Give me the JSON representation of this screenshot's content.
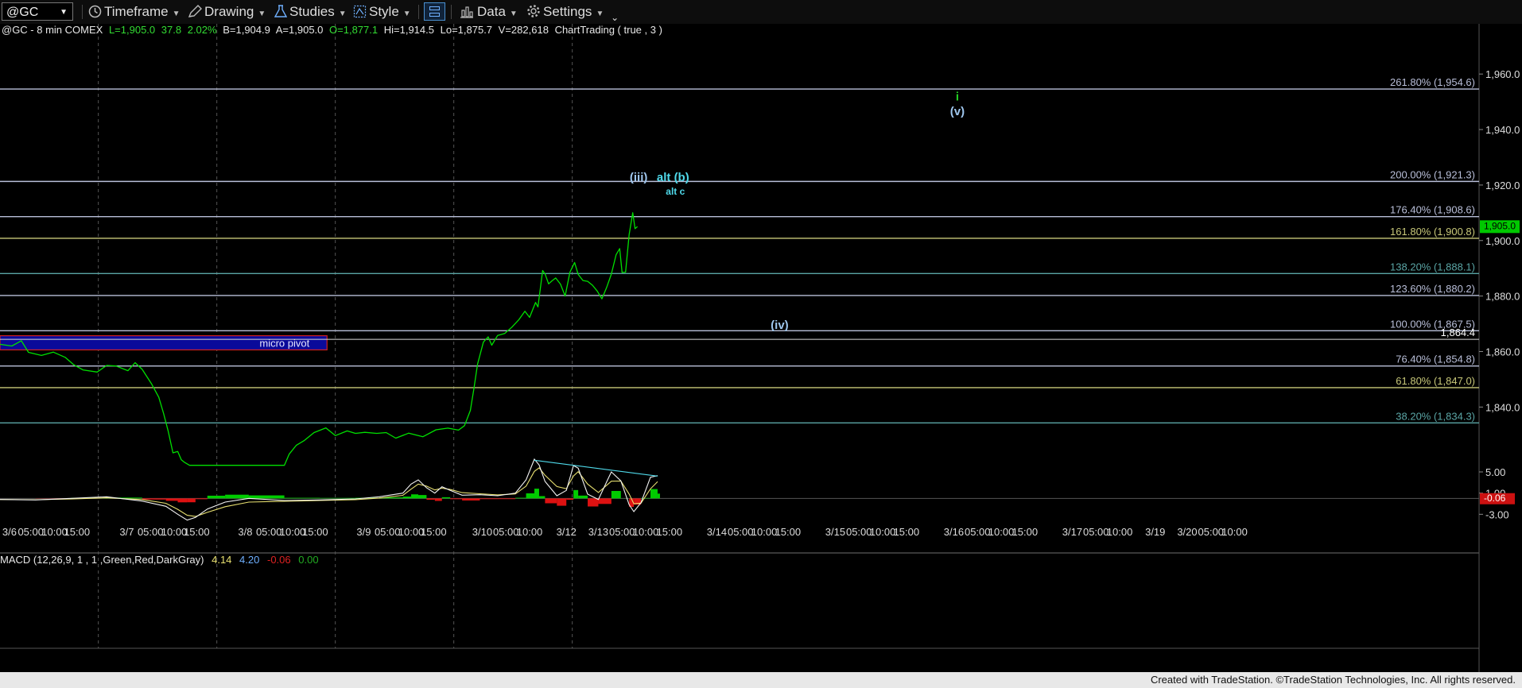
{
  "toolbar": {
    "symbol": "@GC",
    "timeframe": "Timeframe",
    "drawing": "Drawing",
    "studies": "Studies",
    "style": "Style",
    "data": "Data",
    "settings": "Settings"
  },
  "header": {
    "symbol_desc": "@GC - 8 min  COMEX",
    "last": "L=1,905.0",
    "change": "37.8",
    "change_pct": "2.02%",
    "bid": "B=1,904.9",
    "ask": "A=1,905.0",
    "open": "O=1,877.1",
    "high": "Hi=1,914.5",
    "low": "Lo=1,875.7",
    "volume": "V=282,618",
    "indicator": "ChartTrading ( true , 3 )"
  },
  "colors": {
    "price_line": "#00e000",
    "wave_cyan": "#4fd9ea",
    "wave_label": "#9fc7ee",
    "fib_gray": "#b9bfd9",
    "fib_olive": "#c8c879",
    "fib_teal": "#5aa5a5",
    "pivot_fill": "#0a0a9a",
    "macd_neg": "#dd1111"
  },
  "fibs": [
    {
      "label": "261.80% (1,954.6)",
      "price": 1954.6,
      "color": "#b9bfd9"
    },
    {
      "label": "200.00% (1,921.3)",
      "price": 1921.3,
      "color": "#b9bfd9"
    },
    {
      "label": "176.40% (1,908.6)",
      "price": 1908.6,
      "color": "#b9bfd9"
    },
    {
      "label": "161.80% (1,900.8)",
      "price": 1900.8,
      "color": "#c8c879"
    },
    {
      "label": "138.20% (1,888.1)",
      "price": 1888.1,
      "color": "#5aa5a5"
    },
    {
      "label": "123.60% (1,880.2)",
      "price": 1880.2,
      "color": "#b9bfd9"
    },
    {
      "label": "100.00% (1,867.5)",
      "price": 1867.5,
      "color": "#b9bfd9"
    },
    {
      "label": "76.40% (1,854.8)",
      "price": 1854.8,
      "color": "#b9bfd9"
    },
    {
      "label": "61.80% (1,847.0)",
      "price": 1847.0,
      "color": "#c8c879"
    },
    {
      "label": "38.20% (1,834.3)",
      "price": 1834.3,
      "color": "#5aa5a5"
    }
  ],
  "pivot_level": {
    "label": "1,864.4",
    "price": 1864.4
  },
  "micro_pivot": {
    "label": "micro pivot",
    "price_top": 1865.7,
    "price_bottom": 1860.6,
    "bar_start": 0,
    "bar_end": 276
  },
  "price_axis": {
    "ticks": [
      "1,960.0",
      "1,940.0",
      "1,920.0",
      "1,900.0",
      "1,880.0",
      "1,860.0",
      "1,840.0"
    ],
    "values": [
      1960,
      1940,
      1920,
      1900,
      1880,
      1860,
      1840
    ],
    "min": 1823.5,
    "max": 1969.5
  },
  "current_price": {
    "label": "1,905.0",
    "price": 1905.0
  },
  "wave_labels": [
    {
      "text": "(iii)",
      "bar": 539,
      "price": 1921.4,
      "color": "#9fc7ee"
    },
    {
      "text": "alt (b)",
      "bar": 568,
      "price": 1921.4,
      "color": "#4fd9ea"
    },
    {
      "text": "alt c",
      "bar": 570,
      "price": 1916.6,
      "color": "#4fd9ea"
    },
    {
      "text": "(iv)",
      "bar": 658,
      "price": 1868.1,
      "color": "#9fc7ee"
    },
    {
      "text": "i",
      "bar": 808,
      "price": 1950.4,
      "color": "#22cc22"
    },
    {
      "text": "(v)",
      "bar": 808,
      "price": 1945.2,
      "color": "#9fc7ee"
    }
  ],
  "price_path": [
    [
      0,
      1862.6
    ],
    [
      10,
      1862
    ],
    [
      18,
      1863.9
    ],
    [
      24,
      1859.7
    ],
    [
      35,
      1858.6
    ],
    [
      45,
      1859.8
    ],
    [
      55,
      1857.9
    ],
    [
      62,
      1855.3
    ],
    [
      70,
      1853.4
    ],
    [
      82,
      1852.6
    ],
    [
      90,
      1855
    ],
    [
      98,
      1854.8
    ],
    [
      108,
      1853.1
    ],
    [
      114,
      1856
    ],
    [
      120,
      1853.6
    ],
    [
      128,
      1848.3
    ],
    [
      134,
      1843.5
    ],
    [
      138,
      1837.8
    ],
    [
      142,
      1831.2
    ],
    [
      146,
      1823.5
    ],
    [
      150,
      1824
    ],
    [
      153,
      1821
    ],
    [
      156,
      1820
    ],
    [
      160,
      1819
    ],
    [
      240,
      1819
    ],
    [
      244,
      1823
    ],
    [
      250,
      1826.2
    ],
    [
      257,
      1828
    ],
    [
      265,
      1830.8
    ],
    [
      275,
      1832.5
    ],
    [
      283,
      1829.7
    ],
    [
      293,
      1831.4
    ],
    [
      300,
      1830.5
    ],
    [
      308,
      1830.9
    ],
    [
      318,
      1830.5
    ],
    [
      326,
      1830.8
    ],
    [
      334,
      1828.8
    ],
    [
      345,
      1830.6
    ],
    [
      357,
      1829.3
    ],
    [
      368,
      1831.8
    ],
    [
      378,
      1832.4
    ],
    [
      387,
      1831.7
    ],
    [
      392,
      1833.3
    ],
    [
      397,
      1838.8
    ],
    [
      400,
      1846.7
    ],
    [
      403,
      1855.4
    ],
    [
      408,
      1863.4
    ],
    [
      412,
      1865.3
    ],
    [
      415,
      1862.3
    ],
    [
      420,
      1865.8
    ],
    [
      426,
      1866.5
    ],
    [
      432,
      1868.8
    ],
    [
      438,
      1871.5
    ],
    [
      443,
      1874.5
    ],
    [
      447,
      1872.3
    ],
    [
      452,
      1877.7
    ],
    [
      454,
      1876.1
    ],
    [
      456,
      1882.5
    ],
    [
      458,
      1889.2
    ],
    [
      460,
      1888
    ],
    [
      463,
      1884.4
    ],
    [
      466,
      1885.5
    ],
    [
      469,
      1886.5
    ],
    [
      473,
      1884.3
    ],
    [
      477,
      1880
    ],
    [
      481,
      1888.6
    ],
    [
      485,
      1892.1
    ],
    [
      488,
      1887.8
    ],
    [
      492,
      1885.6
    ],
    [
      496,
      1885.3
    ],
    [
      500,
      1883.9
    ],
    [
      504,
      1881.8
    ],
    [
      508,
      1879
    ],
    [
      512,
      1883.1
    ],
    [
      516,
      1887.9
    ],
    [
      520,
      1894.9
    ],
    [
      523,
      1897.1
    ],
    [
      525,
      1888.5
    ],
    [
      528,
      1888.6
    ],
    [
      531,
      1902.2
    ],
    [
      534,
      1910
    ],
    [
      536,
      1904.3
    ],
    [
      538,
      1905
    ]
  ],
  "macd": {
    "label": "MACD (12,26,9, 1 , 1 ,Green,Red,DarkGray)",
    "macd_value": "4.14",
    "signal_value": "4.20",
    "diff_value": "-0.06",
    "zero_value": "0.00",
    "ticks": [
      "5.00",
      "1.00",
      "-3.00"
    ],
    "tick_values": [
      5,
      1,
      -3
    ],
    "min": -5.5,
    "max": 8,
    "current_label": "-0.06",
    "trendline": [
      [
        451,
        7.2
      ],
      [
        555,
        4.2
      ]
    ],
    "line_path": [
      [
        0,
        -0.2
      ],
      [
        30,
        -0.3
      ],
      [
        60,
        0
      ],
      [
        90,
        0.3
      ],
      [
        120,
        -0.5
      ],
      [
        140,
        -1.5
      ],
      [
        150,
        -3
      ],
      [
        158,
        -4.1
      ],
      [
        165,
        -3.6
      ],
      [
        175,
        -2
      ],
      [
        190,
        -0.7
      ],
      [
        210,
        0
      ],
      [
        240,
        -0.4
      ],
      [
        270,
        -0.3
      ],
      [
        300,
        -0.1
      ],
      [
        320,
        0.3
      ],
      [
        340,
        1
      ],
      [
        347,
        2.7
      ],
      [
        353,
        3.5
      ],
      [
        360,
        2
      ],
      [
        367,
        1
      ],
      [
        373,
        2.2
      ],
      [
        380,
        1.5
      ],
      [
        390,
        0.6
      ],
      [
        405,
        0.7
      ],
      [
        420,
        0.5
      ],
      [
        435,
        1
      ],
      [
        444,
        3.5
      ],
      [
        451,
        7.4
      ],
      [
        455,
        6.3
      ],
      [
        460,
        3.2
      ],
      [
        470,
        0.5
      ],
      [
        478,
        1.5
      ],
      [
        484,
        6.2
      ],
      [
        488,
        5.7
      ],
      [
        496,
        0.8
      ],
      [
        505,
        -0.2
      ],
      [
        516,
        5
      ],
      [
        524,
        3.3
      ],
      [
        531,
        -1.2
      ],
      [
        535,
        -2.5
      ],
      [
        541,
        -0.8
      ],
      [
        549,
        4
      ],
      [
        555,
        4.3
      ]
    ]
  },
  "time_axis": {
    "labels": [
      {
        "text": "3/6",
        "bar": 8
      },
      {
        "text": "05:00",
        "bar": 26
      },
      {
        "text": "10:00",
        "bar": 46
      },
      {
        "text": "15:00",
        "bar": 65
      },
      {
        "text": "3/7",
        "bar": 107
      },
      {
        "text": "05:00",
        "bar": 127
      },
      {
        "text": "10:00",
        "bar": 147
      },
      {
        "text": "15:00",
        "bar": 166
      },
      {
        "text": "3/8",
        "bar": 207
      },
      {
        "text": "05:00",
        "bar": 227
      },
      {
        "text": "10:00",
        "bar": 247
      },
      {
        "text": "15:00",
        "bar": 266
      },
      {
        "text": "3/9",
        "bar": 307
      },
      {
        "text": "05:00",
        "bar": 327
      },
      {
        "text": "10:00",
        "bar": 347
      },
      {
        "text": "15:00",
        "bar": 366
      },
      {
        "text": "3/10",
        "bar": 407
      },
      {
        "text": "05:00",
        "bar": 427
      },
      {
        "text": "10:00",
        "bar": 447
      },
      {
        "text": "3/12",
        "bar": 478
      },
      {
        "text": "3/13",
        "bar": 505
      },
      {
        "text": "05:00",
        "bar": 525
      },
      {
        "text": "10:00",
        "bar": 545
      },
      {
        "text": "15:00",
        "bar": 565
      },
      {
        "text": "3/14",
        "bar": 605
      },
      {
        "text": "05:00",
        "bar": 625
      },
      {
        "text": "10:00",
        "bar": 645
      },
      {
        "text": "15:00",
        "bar": 665
      },
      {
        "text": "3/15",
        "bar": 705
      },
      {
        "text": "05:00",
        "bar": 725
      },
      {
        "text": "10:00",
        "bar": 745
      },
      {
        "text": "15:00",
        "bar": 765
      },
      {
        "text": "3/16",
        "bar": 805
      },
      {
        "text": "05:00",
        "bar": 825
      },
      {
        "text": "10:00",
        "bar": 845
      },
      {
        "text": "15:00",
        "bar": 865
      },
      {
        "text": "3/17",
        "bar": 905
      },
      {
        "text": "05:00",
        "bar": 925
      },
      {
        "text": "10:00",
        "bar": 945
      },
      {
        "text": "3/19",
        "bar": 975
      },
      {
        "text": "3/20",
        "bar": 1002
      },
      {
        "text": "05:00",
        "bar": 1022
      },
      {
        "text": "10:00",
        "bar": 1042
      }
    ],
    "session_breaks": [
      83,
      183,
      283,
      383,
      483
    ]
  },
  "footer": "Created with TradeStation. ©TradeStation Technologies, Inc. All rights reserved."
}
